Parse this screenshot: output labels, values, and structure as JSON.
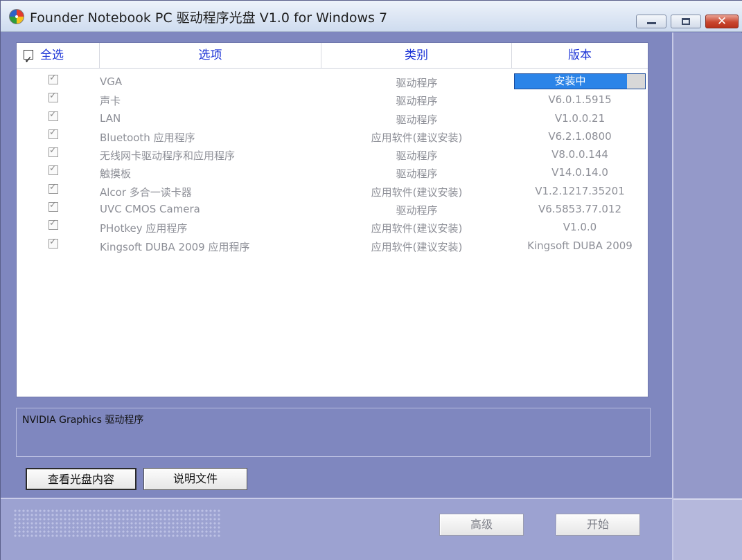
{
  "window": {
    "title": "Founder Notebook PC 驱动程序光盘 V1.0 for Windows 7",
    "close_glyph": "✕"
  },
  "list": {
    "headers": {
      "select_all": "全选",
      "option": "选项",
      "category": "类别",
      "version": "版本"
    },
    "select_all_checked": true,
    "rows": [
      {
        "name": "VGA",
        "category": "驱动程序",
        "version": "安装中",
        "checked": true,
        "installing": true
      },
      {
        "name": "声卡",
        "category": "驱动程序",
        "version": "V6.0.1.5915",
        "checked": true
      },
      {
        "name": "LAN",
        "category": "驱动程序",
        "version": "V1.0.0.21",
        "checked": true
      },
      {
        "name": "Bluetooth 应用程序",
        "category": "应用软件(建议安装)",
        "version": "V6.2.1.0800",
        "checked": true
      },
      {
        "name": "无线网卡驱动程序和应用程序",
        "category": "驱动程序",
        "version": "V8.0.0.144",
        "checked": true
      },
      {
        "name": "触摸板",
        "category": "驱动程序",
        "version": "V14.0.14.0",
        "checked": true
      },
      {
        "name": "Alcor 多合一读卡器",
        "category": "应用软件(建议安装)",
        "version": "V1.2.1217.35201",
        "checked": true
      },
      {
        "name": "UVC CMOS Camera",
        "category": "驱动程序",
        "version": "V6.5853.77.012",
        "checked": true
      },
      {
        "name": "PHotkey 应用程序",
        "category": "应用软件(建议安装)",
        "version": "V1.0.0",
        "checked": true
      },
      {
        "name": "Kingsoft DUBA 2009 应用程序",
        "category": "应用软件(建议安装)",
        "version": "Kingsoft DUBA 2009",
        "checked": true
      }
    ]
  },
  "description": {
    "text": "NVIDIA Graphics 驱动程序"
  },
  "buttons": {
    "view_disc": "查看光盘内容",
    "readme": "说明文件",
    "advanced": "高级",
    "start": "开始"
  },
  "colors": {
    "frame": "#7f87bf",
    "header_text": "#1a32d6",
    "installing_bg": "#2b84e8",
    "row_text": "#8d8f97"
  }
}
